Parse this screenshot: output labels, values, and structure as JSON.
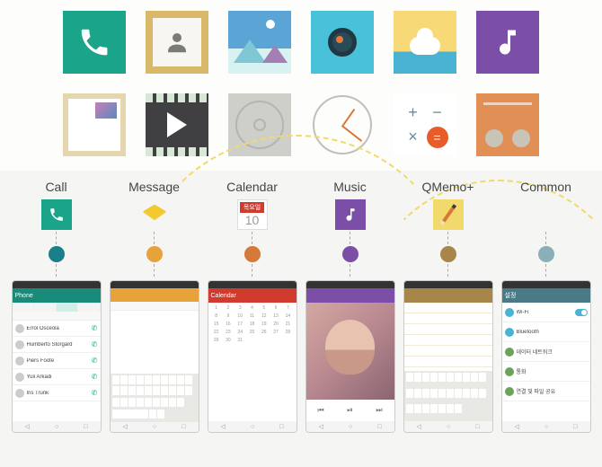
{
  "icons_row1": [
    "phone",
    "contacts",
    "gallery",
    "camera",
    "weather",
    "music"
  ],
  "icons_row2": [
    "notes",
    "video",
    "disk",
    "clock",
    "calculator",
    "radio"
  ],
  "apps": [
    {
      "label": "Call",
      "color": "#1a7f8a",
      "action_bar": "Phone"
    },
    {
      "label": "Message",
      "color": "#e8a23a",
      "action_bar": ""
    },
    {
      "label": "Calendar",
      "color": "#d67838",
      "action_bar": "Calendar"
    },
    {
      "label": "Music",
      "color": "#7b4ea8",
      "action_bar": ""
    },
    {
      "label": "QMemo+",
      "color": "#a88548",
      "action_bar": ""
    },
    {
      "label": "Common",
      "color": "#8aafb8",
      "action_bar": "설정"
    }
  ],
  "calendar_icon": {
    "day_label": "목요일",
    "day_number": "10"
  },
  "call_contacts": [
    "Errol Osceola",
    "Humberto Storgard",
    "Piers Foote",
    "Yuli Arkadi",
    "Iris Trunk"
  ],
  "settings_items": [
    "Wi-Fi",
    "Bluetooth",
    "데이터 네트워크",
    "통화",
    "연결 및 파일 공유"
  ],
  "calc_ops": [
    "+",
    "−",
    "×",
    "="
  ],
  "music_controls": [
    "⏮",
    "⏯",
    "⏭"
  ],
  "nav_buttons": [
    "◁",
    "○",
    "□"
  ]
}
